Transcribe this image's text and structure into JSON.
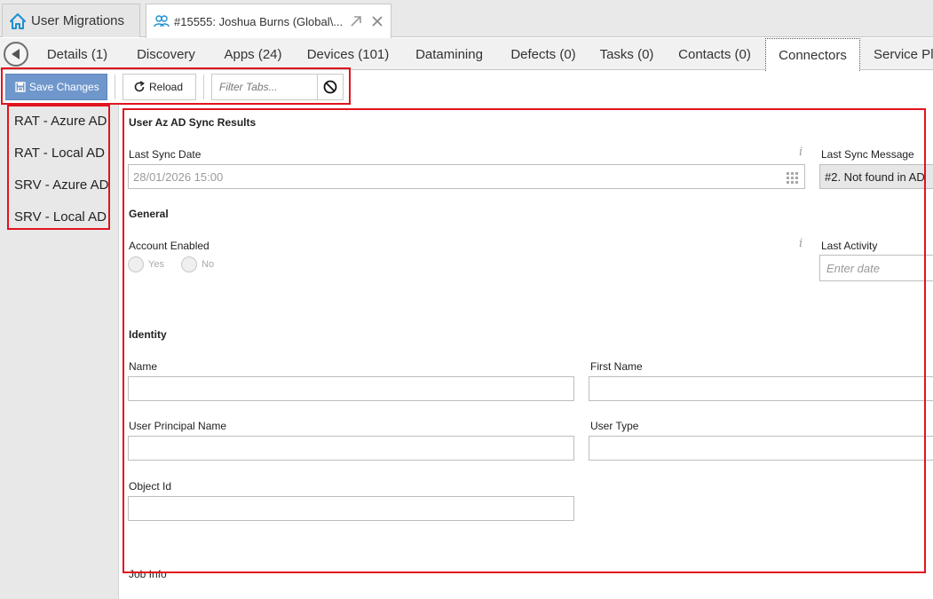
{
  "window_tabs": [
    {
      "label": "User Migrations",
      "icon": "home-icon"
    },
    {
      "label": "#15555: Joshua Burns (Global\\...",
      "icon": "people-icon"
    }
  ],
  "nav_tabs": [
    {
      "label": "Details (1)"
    },
    {
      "label": "Discovery"
    },
    {
      "label": "Apps (24)"
    },
    {
      "label": "Devices (101)"
    },
    {
      "label": "Datamining"
    },
    {
      "label": "Defects (0)"
    },
    {
      "label": "Tasks (0)"
    },
    {
      "label": "Contacts (0)"
    },
    {
      "label": "Connectors"
    },
    {
      "label": "Service Pla"
    }
  ],
  "toolbar": {
    "save_label": "Save Changes",
    "reload_label": "Reload",
    "filter_placeholder": "Filter Tabs..."
  },
  "left_list": [
    {
      "label": "RAT - Azure AD"
    },
    {
      "label": "RAT - Local AD"
    },
    {
      "label": "SRV - Azure AD"
    },
    {
      "label": "SRV - Local AD"
    }
  ],
  "main": {
    "sync_section_title": "User Az AD Sync Results",
    "last_sync_date_label": "Last Sync Date",
    "last_sync_date_value": "28/01/2026 15:00",
    "last_sync_message_label": "Last Sync Message",
    "last_sync_message_value": "#2. Not found in AD",
    "general_title": "General",
    "account_enabled_label": "Account Enabled",
    "yes_label": "Yes",
    "no_label": "No",
    "last_activity_label": "Last Activity",
    "last_activity_placeholder": "Enter date",
    "identity_title": "Identity",
    "name_label": "Name",
    "first_name_label": "First Name",
    "upn_label": "User Principal Name",
    "user_type_label": "User Type",
    "object_id_label": "Object Id",
    "job_info_title": "Job Info"
  },
  "colors": {
    "highlight_border": "#e0141e",
    "save_button": "#6f97cc"
  }
}
